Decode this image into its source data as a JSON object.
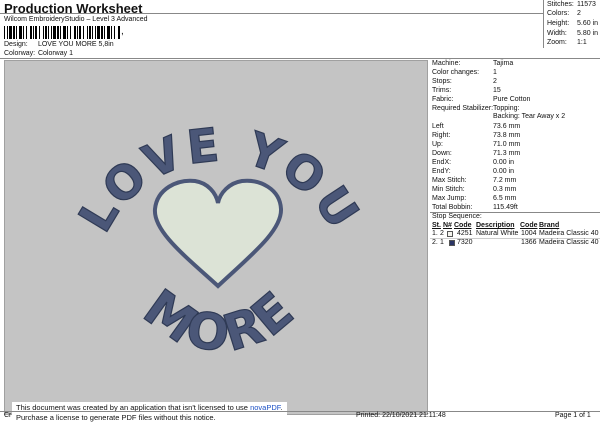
{
  "header": {
    "title": "Production Worksheet",
    "subtitle": "Wilcom EmbroideryStudio – Level 3 Advanced",
    "barcode_suffix": ","
  },
  "design": {
    "label": "Design:",
    "value": "LOVE YOU MORE 5,8in"
  },
  "colorway": {
    "label": "Colorway:",
    "value": "Colorway 1"
  },
  "stats": [
    {
      "label": "Stitches:",
      "value": "11573"
    },
    {
      "label": "Colors:",
      "value": "2"
    },
    {
      "label": "Height:",
      "value": "5.60 in"
    },
    {
      "label": "Width:",
      "value": "5.80 in"
    },
    {
      "label": "Zoom:",
      "value": "1:1"
    }
  ],
  "artwork": {
    "top_text": "LOVE YOU",
    "bottom_text": "MORE",
    "thread_color": "#4b5778",
    "heart_fill": "#dce3d6",
    "background": "#c4c4c4"
  },
  "info": [
    {
      "label": "Machine:",
      "value": "Tajima"
    },
    {
      "label": "Color changes:",
      "value": "1"
    },
    {
      "label": "Stops:",
      "value": "2"
    },
    {
      "label": "Trims:",
      "value": "15"
    },
    {
      "label": "Fabric:",
      "value": "Pure Cotton"
    },
    {
      "label": "Required Stabilizer:",
      "value": "Topping:"
    },
    {
      "label": "",
      "value": "Backing: Tear Away x 2"
    },
    {
      "label": "Left",
      "value": "73.6 mm"
    },
    {
      "label": "Right:",
      "value": "73.8 mm"
    },
    {
      "label": "Up:",
      "value": "71.0 mm"
    },
    {
      "label": "Down:",
      "value": "71.3 mm"
    },
    {
      "label": "EndX:",
      "value": "0.00 in"
    },
    {
      "label": "EndY:",
      "value": "0.00 in"
    },
    {
      "label": "Max Stitch:",
      "value": "7.2 mm"
    },
    {
      "label": "Min Stitch:",
      "value": "0.3 mm"
    },
    {
      "label": "Max Jump:",
      "value": "6.5 mm"
    },
    {
      "label": "Total Bobbin:",
      "value": "115.49ft"
    }
  ],
  "stop_sequence": {
    "title": "Stop Sequence:",
    "headers": [
      "St.",
      "N#",
      "Code",
      "Description",
      "Code",
      "Brand"
    ],
    "rows": [
      {
        "st": "1.",
        "n": "2",
        "code": "4251",
        "description": "Natural White",
        "code2": "1004",
        "brand": "Madeira Classic 40",
        "swatch": "#f4f4ee"
      },
      {
        "st": "2.",
        "n": "1",
        "code": "7320",
        "description": "",
        "code2": "1366",
        "brand": "Madeira Classic 40",
        "swatch": "#2b3565"
      }
    ]
  },
  "footer": {
    "notice_line1": "This document was created by an application that isn't licensed to use",
    "notice_link": "novaPDF",
    "notice_line2": "Purchase a license to generate PDF files without this notice.",
    "left_fragment": "Cr",
    "printed": "Printed: 22/10/2021 21:11:48",
    "page": "Page 1 of 1"
  }
}
